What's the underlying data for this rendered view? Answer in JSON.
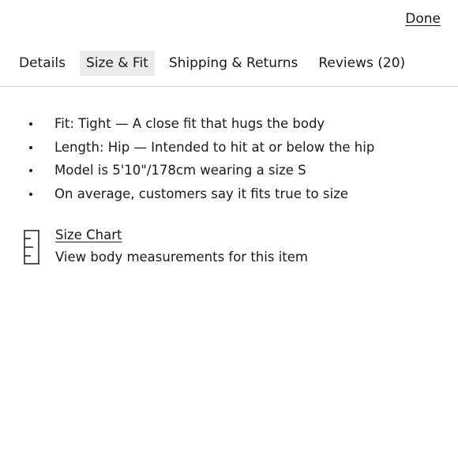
{
  "header": {
    "done_label": "Done"
  },
  "tabs": [
    {
      "label": "Details"
    },
    {
      "label": "Size & Fit"
    },
    {
      "label": "Shipping & Returns"
    },
    {
      "label": "Reviews (20)"
    }
  ],
  "fit_details": [
    "Fit: Tight — A close fit that hugs the body",
    "Length: Hip — Intended to hit at or below the hip",
    "Model is 5'10\"/178cm wearing a size S",
    "On average, customers say it fits true to size"
  ],
  "size_chart": {
    "link_label": "Size Chart",
    "description": "View body measurements for this item",
    "icon": "ruler-icon"
  },
  "colors": {
    "active_tab_bg": "#ececec",
    "text": "#1a1a1a",
    "divider": "#dcdcdc"
  }
}
